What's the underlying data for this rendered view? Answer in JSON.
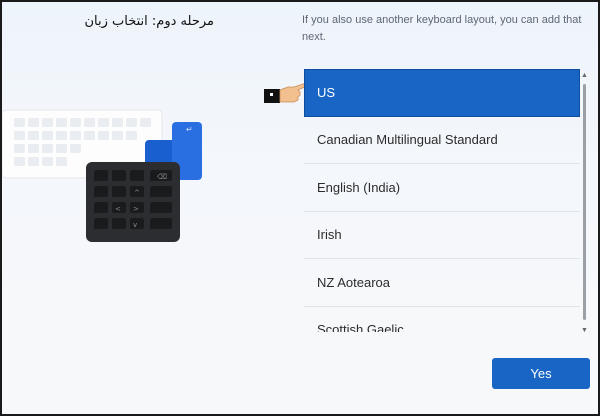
{
  "caption": "مرحله دوم: انتخاب زبان",
  "instruction": "If you also use another keyboard layout, you can add that next.",
  "layouts": {
    "items": [
      {
        "label": "US",
        "selected": true
      },
      {
        "label": "Canadian Multilingual Standard"
      },
      {
        "label": "English (India)"
      },
      {
        "label": "Irish"
      },
      {
        "label": "NZ Aotearoa"
      },
      {
        "label": "Scottish Gaelic"
      }
    ]
  },
  "yes_button": "Yes",
  "colors": {
    "accent": "#1865c6",
    "muted_text": "#5d6673"
  }
}
